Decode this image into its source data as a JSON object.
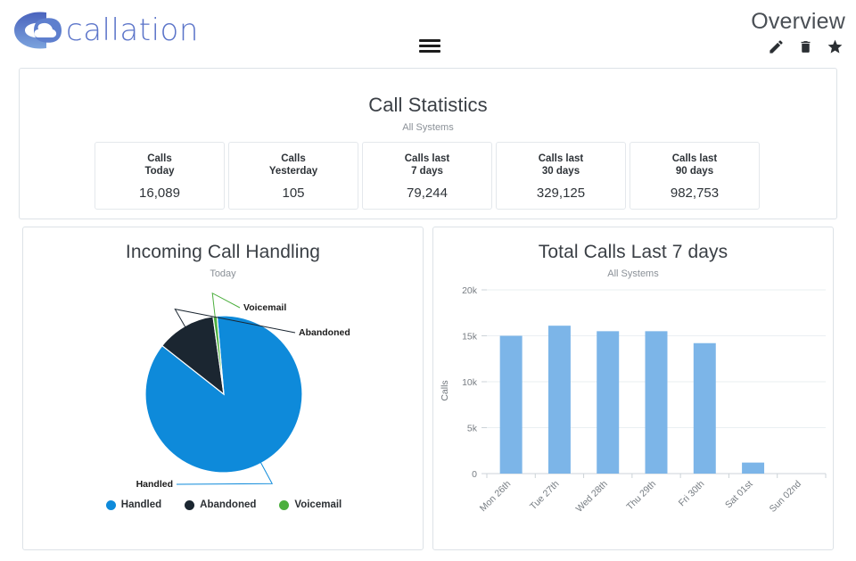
{
  "header": {
    "logo_text": "callation",
    "logo_icon": "callation-c-logo",
    "menu_icon": "hamburger-menu-icon",
    "page_title": "Overview",
    "actions": [
      {
        "name": "edit-button",
        "icon": "pencil-icon"
      },
      {
        "name": "delete-button",
        "icon": "trash-icon"
      },
      {
        "name": "favorite-button",
        "icon": "star-icon"
      }
    ]
  },
  "stats_panel": {
    "title": "Call Statistics",
    "subtitle": "All Systems",
    "cards": [
      {
        "label": "Calls\nToday",
        "value": "16,089"
      },
      {
        "label": "Calls\nYesterday",
        "value": "105"
      },
      {
        "label": "Calls last\n7 days",
        "value": "79,244"
      },
      {
        "label": "Calls last\n30 days",
        "value": "329,125"
      },
      {
        "label": "Calls last\n90 days",
        "value": "982,753"
      }
    ]
  },
  "colors": {
    "handled": "#0e8ada",
    "abandoned": "#1b2631",
    "voicemail": "#4caf3e",
    "bar": "#7cb5e8",
    "logo_blue": "#4a63bd",
    "logo_text": "#5b74c9",
    "panel_border": "#dde2e7",
    "grid": "#eaeff2"
  },
  "chart_data": [
    {
      "type": "pie",
      "title": "Incoming Call Handling",
      "subtitle": "Today",
      "categories": [
        "Handled",
        "Abandoned",
        "Voicemail"
      ],
      "values": [
        87.0,
        12.2,
        0.8
      ],
      "colors": [
        "#0e8ada",
        "#1b2631",
        "#4caf3e"
      ],
      "labels": [
        "Handled",
        "Abandoned",
        "Voicemail"
      ],
      "legend": [
        "Handled",
        "Abandoned",
        "Voicemail"
      ],
      "legend_position": "bottom",
      "start_angle": -5,
      "annotations": [
        "Voicemail",
        "Abandoned",
        "Handled"
      ]
    },
    {
      "type": "bar",
      "title": "Total Calls Last 7 days",
      "subtitle": "All Systems",
      "categories": [
        "Mon 26th",
        "Tue 27th",
        "Wed 28th",
        "Thu 29th",
        "Fri 30th",
        "Sat 01st",
        "Sun 02nd"
      ],
      "values": [
        15000,
        16100,
        15500,
        15500,
        14200,
        1200,
        0
      ],
      "xlabel": "",
      "ylabel": "Calls",
      "ylim": [
        0,
        20000
      ],
      "yticks": [
        0,
        5000,
        10000,
        15000,
        20000
      ],
      "ytick_labels": [
        "0",
        "5k",
        "10k",
        "15k",
        "20k"
      ],
      "grid": true,
      "color": "#7cb5e8"
    }
  ]
}
